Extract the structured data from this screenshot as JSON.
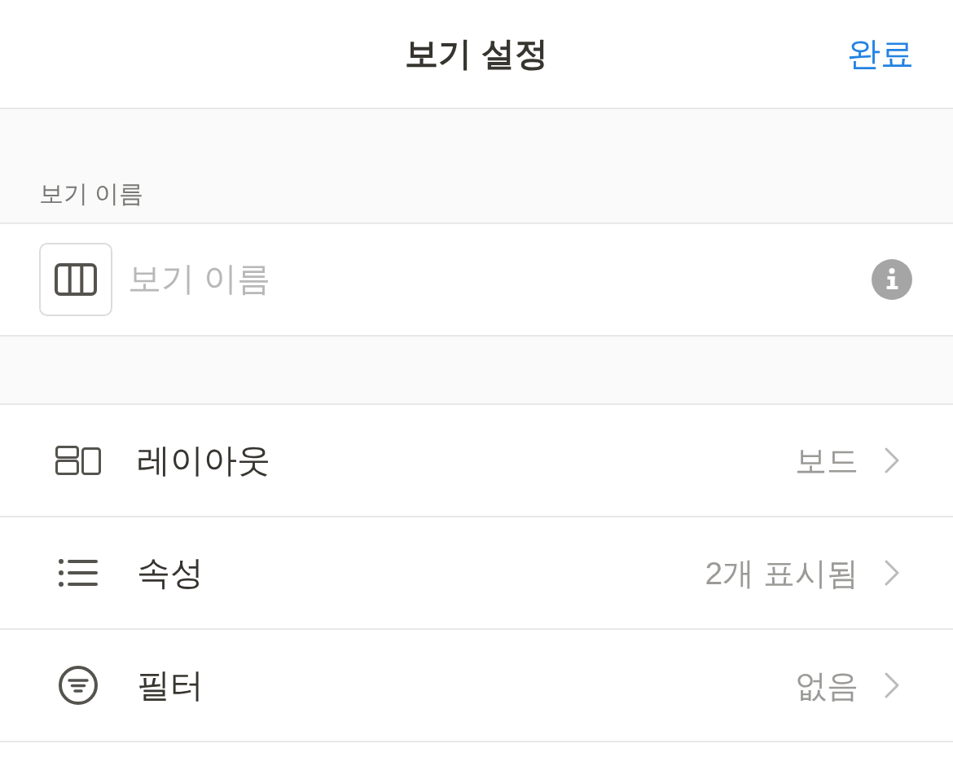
{
  "header": {
    "title": "보기 설정",
    "done_button": "완료"
  },
  "name_section": {
    "label": "보기 이름",
    "field": {
      "placeholder": "보기 이름"
    }
  },
  "settings": [
    {
      "kind": "layout",
      "label": "레이아웃",
      "value": "보드"
    },
    {
      "kind": "properties",
      "label": "속성",
      "value": "2개 표시됨"
    },
    {
      "kind": "filter",
      "label": "필터",
      "value": "없음"
    }
  ]
}
